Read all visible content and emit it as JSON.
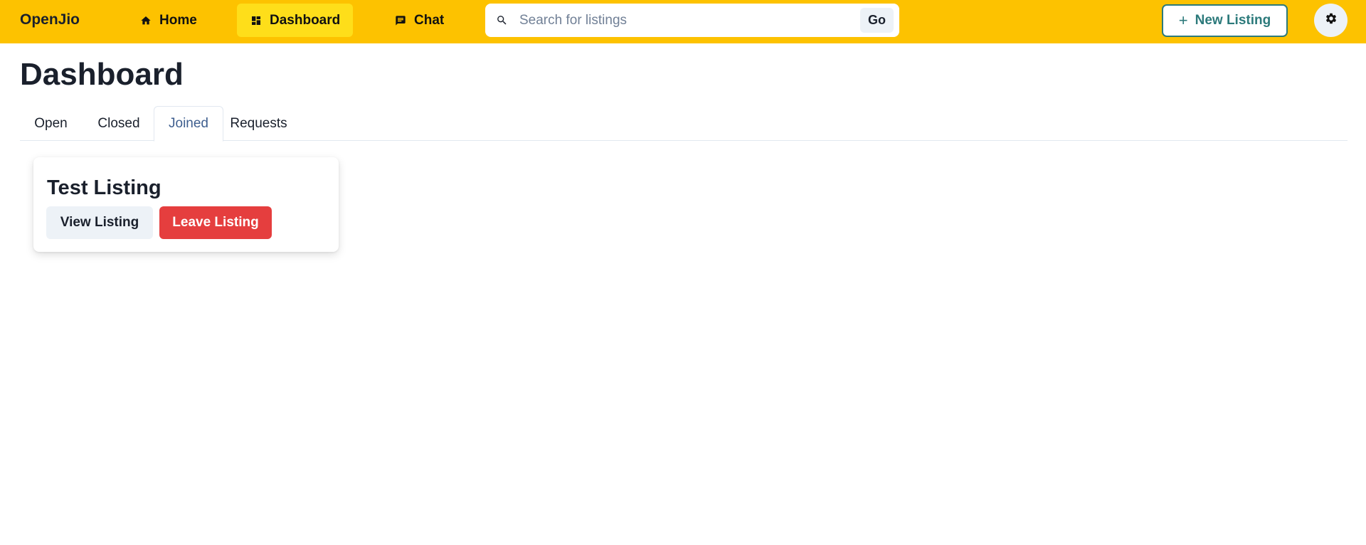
{
  "navbar": {
    "brand": "OpenJio",
    "items": [
      {
        "label": "Home",
        "icon": "home-icon"
      },
      {
        "label": "Dashboard",
        "icon": "dashboard-icon",
        "active": true
      },
      {
        "label": "Chat",
        "icon": "chat-icon"
      }
    ],
    "search": {
      "placeholder": "Search for listings",
      "value": "",
      "go_label": "Go",
      "icon": "search-icon"
    },
    "new_listing": {
      "label": "New Listing",
      "icon": "plus-icon"
    },
    "settings": {
      "icon": "gear-icon"
    }
  },
  "page": {
    "title": "Dashboard"
  },
  "tabs": [
    {
      "label": "Open"
    },
    {
      "label": "Closed"
    },
    {
      "label": "Joined",
      "active": true
    },
    {
      "label": "Requests"
    }
  ],
  "listings": [
    {
      "title": "Test Listing",
      "view_label": "View Listing",
      "leave_label": "Leave Listing"
    }
  ],
  "colors": {
    "navbar": "#fdc200",
    "nav_active": "#fede1a",
    "accent_teal": "#2c7a7b",
    "danger": "#e53e3e",
    "active_tab_text": "#3f5f8f"
  }
}
